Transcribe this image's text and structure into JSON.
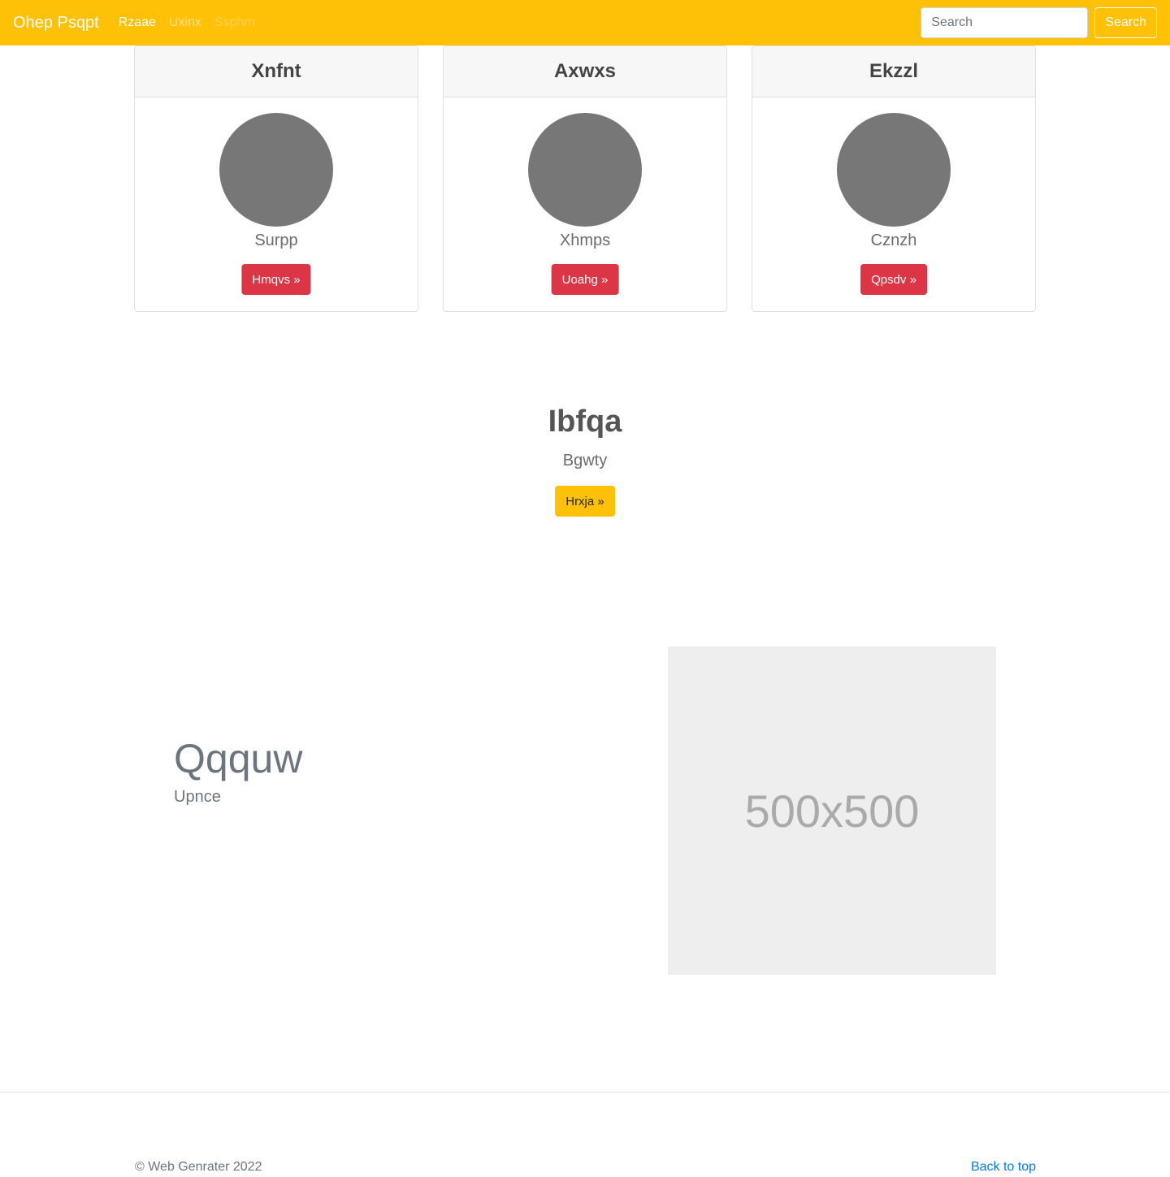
{
  "navbar": {
    "brand": "Ohep Psqpt",
    "links": [
      "Rzaae",
      "Uxinx",
      "Ssphm"
    ],
    "search_placeholder": "Search",
    "search_button": "Search"
  },
  "cards": [
    {
      "title": "Xnfnt",
      "text": "Surpp",
      "button": "Hmqvs »"
    },
    {
      "title": "Axwxs",
      "text": "Xhmps",
      "button": "Uoahg »"
    },
    {
      "title": "Ekzzl",
      "text": "Cznzh",
      "button": "Qpsdv »"
    }
  ],
  "hero": {
    "title": "Ibfqa",
    "subtitle": "Bgwty",
    "button": "Hrxja »"
  },
  "feature": {
    "title": "Qqquw",
    "subtitle": "Upnce",
    "image_label": "500x500"
  },
  "footer": {
    "copyright": "© Web Genrater 2022",
    "back_to_top": "Back to top"
  },
  "colors": {
    "navbar": "#ffc107",
    "danger": "#dc3545",
    "warning": "#ffc107",
    "link": "#007bff"
  }
}
